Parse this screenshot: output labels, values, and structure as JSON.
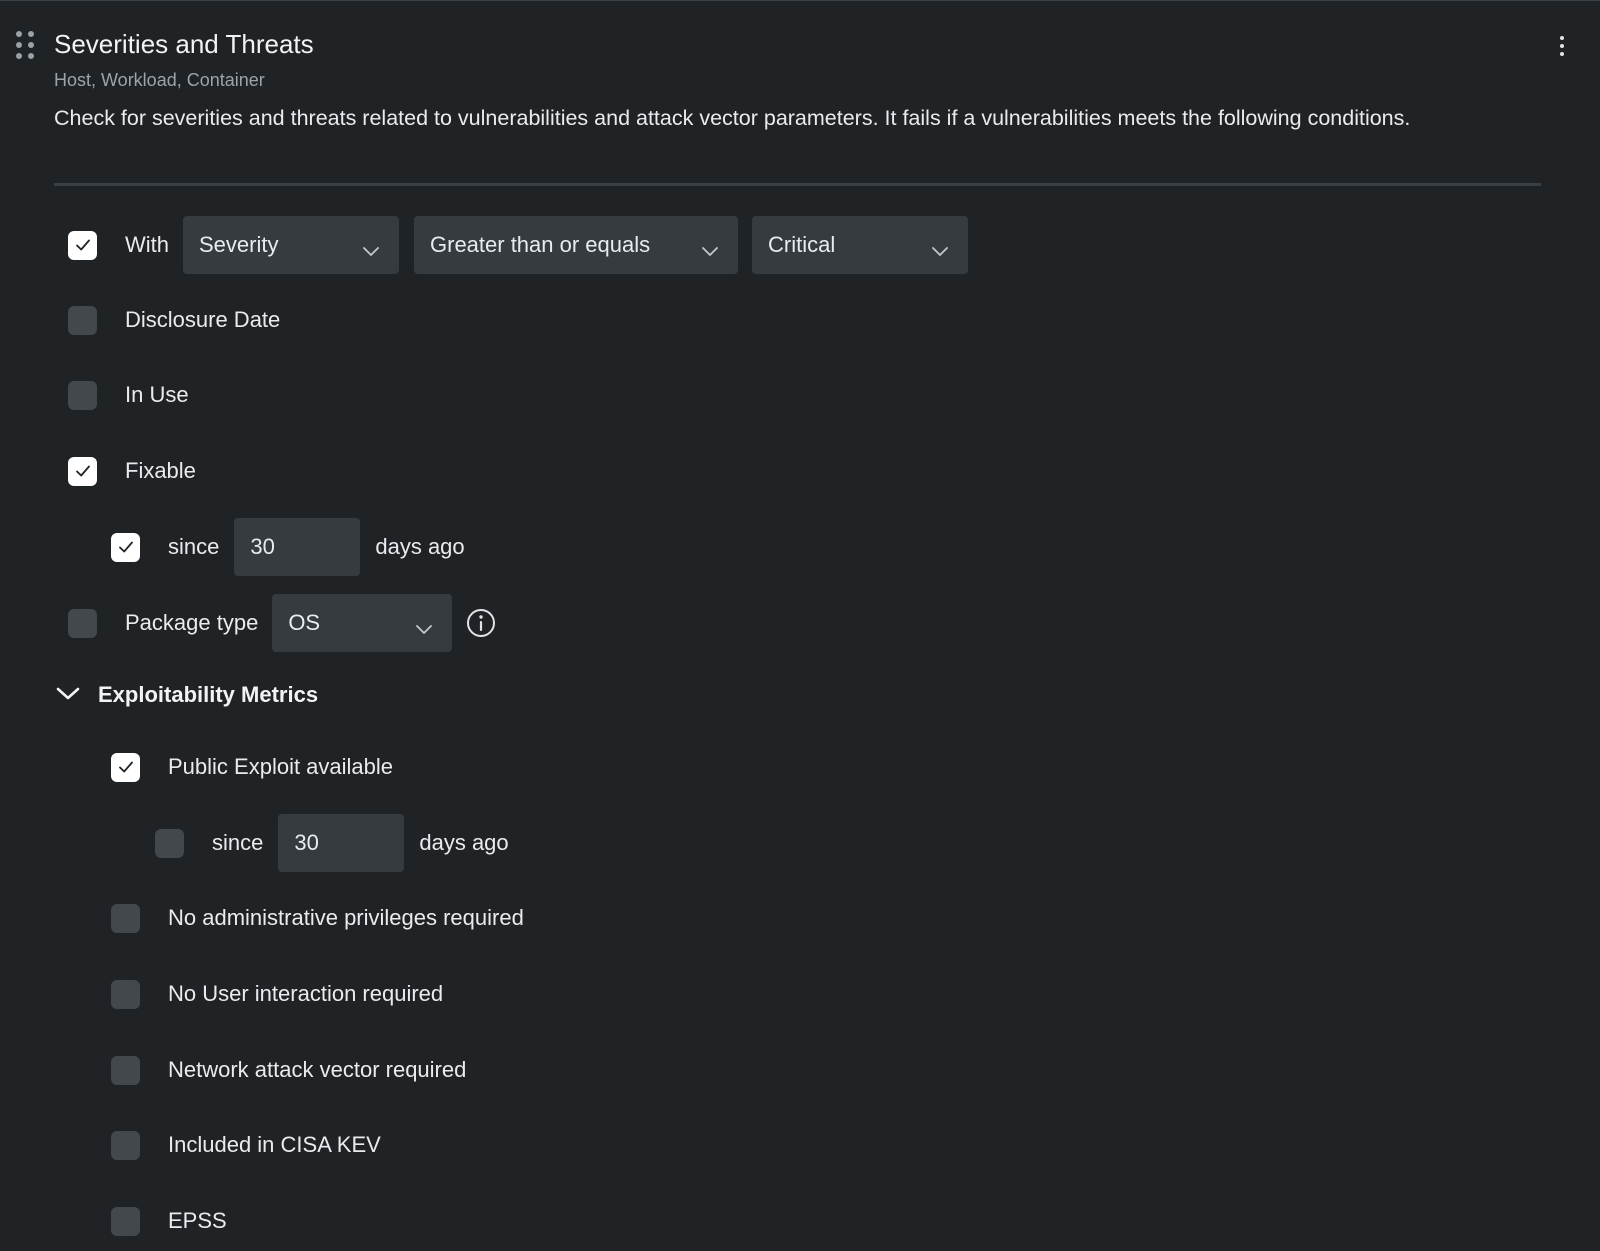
{
  "card": {
    "title": "Severities and Threats",
    "subtitle": "Host, Workload, Container",
    "description": "Check for severities and threats related to vulnerabilities and attack vector parameters. It fails if a vulnerabilities meets the following conditions."
  },
  "conditions": {
    "with": {
      "checked": true,
      "label": "With",
      "field": "Severity",
      "operator": "Greater than or equals",
      "value": "Critical"
    },
    "disclosure_date": {
      "checked": false,
      "label": "Disclosure Date"
    },
    "in_use": {
      "checked": false,
      "label": "In Use"
    },
    "fixable": {
      "checked": true,
      "label": "Fixable",
      "since": {
        "checked": true,
        "label": "since",
        "value": "30",
        "suffix": "days ago"
      }
    },
    "package_type": {
      "checked": false,
      "label": "Package type",
      "value": "OS"
    }
  },
  "exploitability": {
    "title": "Exploitability Metrics",
    "expanded": true,
    "public_exploit": {
      "checked": true,
      "label": "Public Exploit available",
      "since": {
        "checked": false,
        "label": "since",
        "value": "30",
        "suffix": "days ago"
      }
    },
    "no_admin": {
      "checked": false,
      "label": "No administrative privileges required"
    },
    "no_user_interaction": {
      "checked": false,
      "label": "No User interaction required"
    },
    "network_attack": {
      "checked": false,
      "label": "Network attack vector required"
    },
    "cisa_kev": {
      "checked": false,
      "label": "Included in CISA KEV"
    },
    "epss": {
      "checked": false,
      "label": "EPSS"
    }
  },
  "icons": {
    "drag": "drag-handle-icon",
    "menu": "more-vertical-icon",
    "chevron": "chevron-down-icon",
    "check": "check-icon",
    "info": "info-icon"
  },
  "colors": {
    "background": "#1f2326",
    "input_background": "#363b40",
    "checkbox_unchecked": "#43484d",
    "checkbox_checked": "#ffffff",
    "divider": "#3a3f44"
  }
}
